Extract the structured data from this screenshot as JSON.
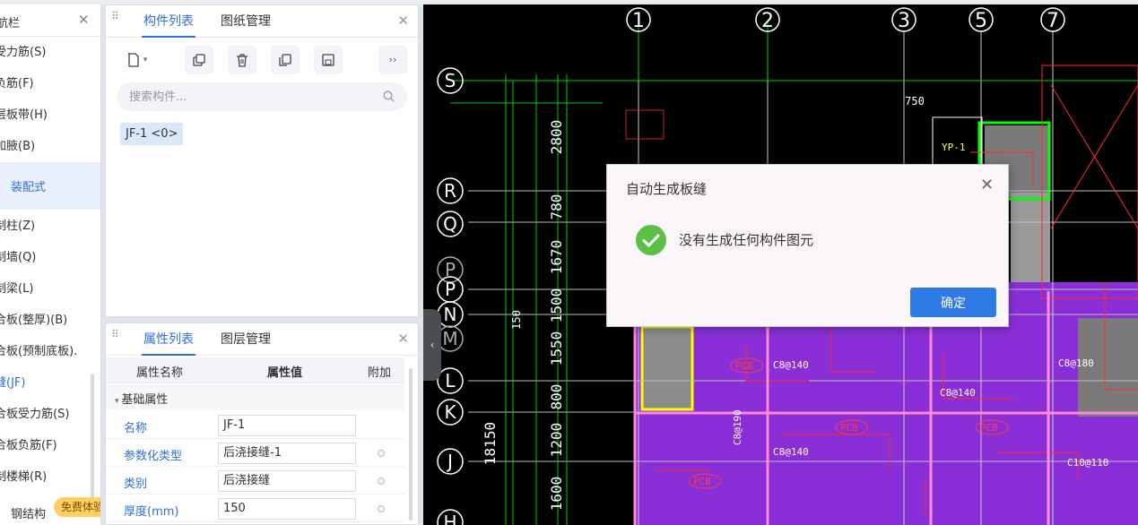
{
  "nav": {
    "title": "航栏",
    "items": [
      "受力筋(S)",
      "负筋(F)",
      "层板带(H)",
      "加腋(B)"
    ],
    "group_label": "装配式",
    "items2": [
      "制柱(Z)",
      "制墙(Q)",
      "制梁(L)",
      "合板(整厚)(B)",
      "合板(预制底板).",
      "缝(JF)",
      "合板受力筋(S)",
      "合板负筋(F)",
      "制楼梯(R)"
    ],
    "active_item": "缝(JF)",
    "bottom_item": "钢结构",
    "free_badge": "免费体验"
  },
  "component_panel": {
    "tabs": [
      "构件列表",
      "图纸管理"
    ],
    "search_placeholder": "搜索构件...",
    "items": [
      "JF-1 <0>"
    ],
    "more_button": "››"
  },
  "property_panel": {
    "tabs": [
      "属性列表",
      "图层管理"
    ],
    "columns": [
      "属性名称",
      "属性值",
      "附加"
    ],
    "group": "基础属性",
    "rows": [
      {
        "name": "名称",
        "value": "JF-1",
        "has_dot": false
      },
      {
        "name": "参数化类型",
        "value": "后浇接缝-1",
        "has_dot": true
      },
      {
        "name": "类别",
        "value": "后浇接缝",
        "has_dot": true
      },
      {
        "name": "厚度(mm)",
        "value": "150",
        "has_dot": true
      }
    ]
  },
  "canvas": {
    "column_labels": [
      "1",
      "2",
      "3",
      "5",
      "7"
    ],
    "row_labels": [
      "S",
      "R",
      "Q",
      "P",
      "P",
      "N",
      "M",
      "L",
      "K",
      "J",
      "H"
    ],
    "dimensions_vertical": [
      "2800",
      "780",
      "1670",
      "1500",
      "1550",
      "800",
      "1200",
      "1600"
    ],
    "dim_750": "750",
    "dim_150": "150",
    "dim_total": "18150",
    "tags": [
      "YP-1",
      "PCB",
      "PCB",
      "PCB",
      "PCB",
      "C8@140",
      "C8@140",
      "C8@140",
      "C8@180",
      "C8@190",
      "C10@110"
    ]
  },
  "dialog": {
    "title": "自动生成板缝",
    "message": "没有生成任何构件图元",
    "ok_label": "确定"
  }
}
